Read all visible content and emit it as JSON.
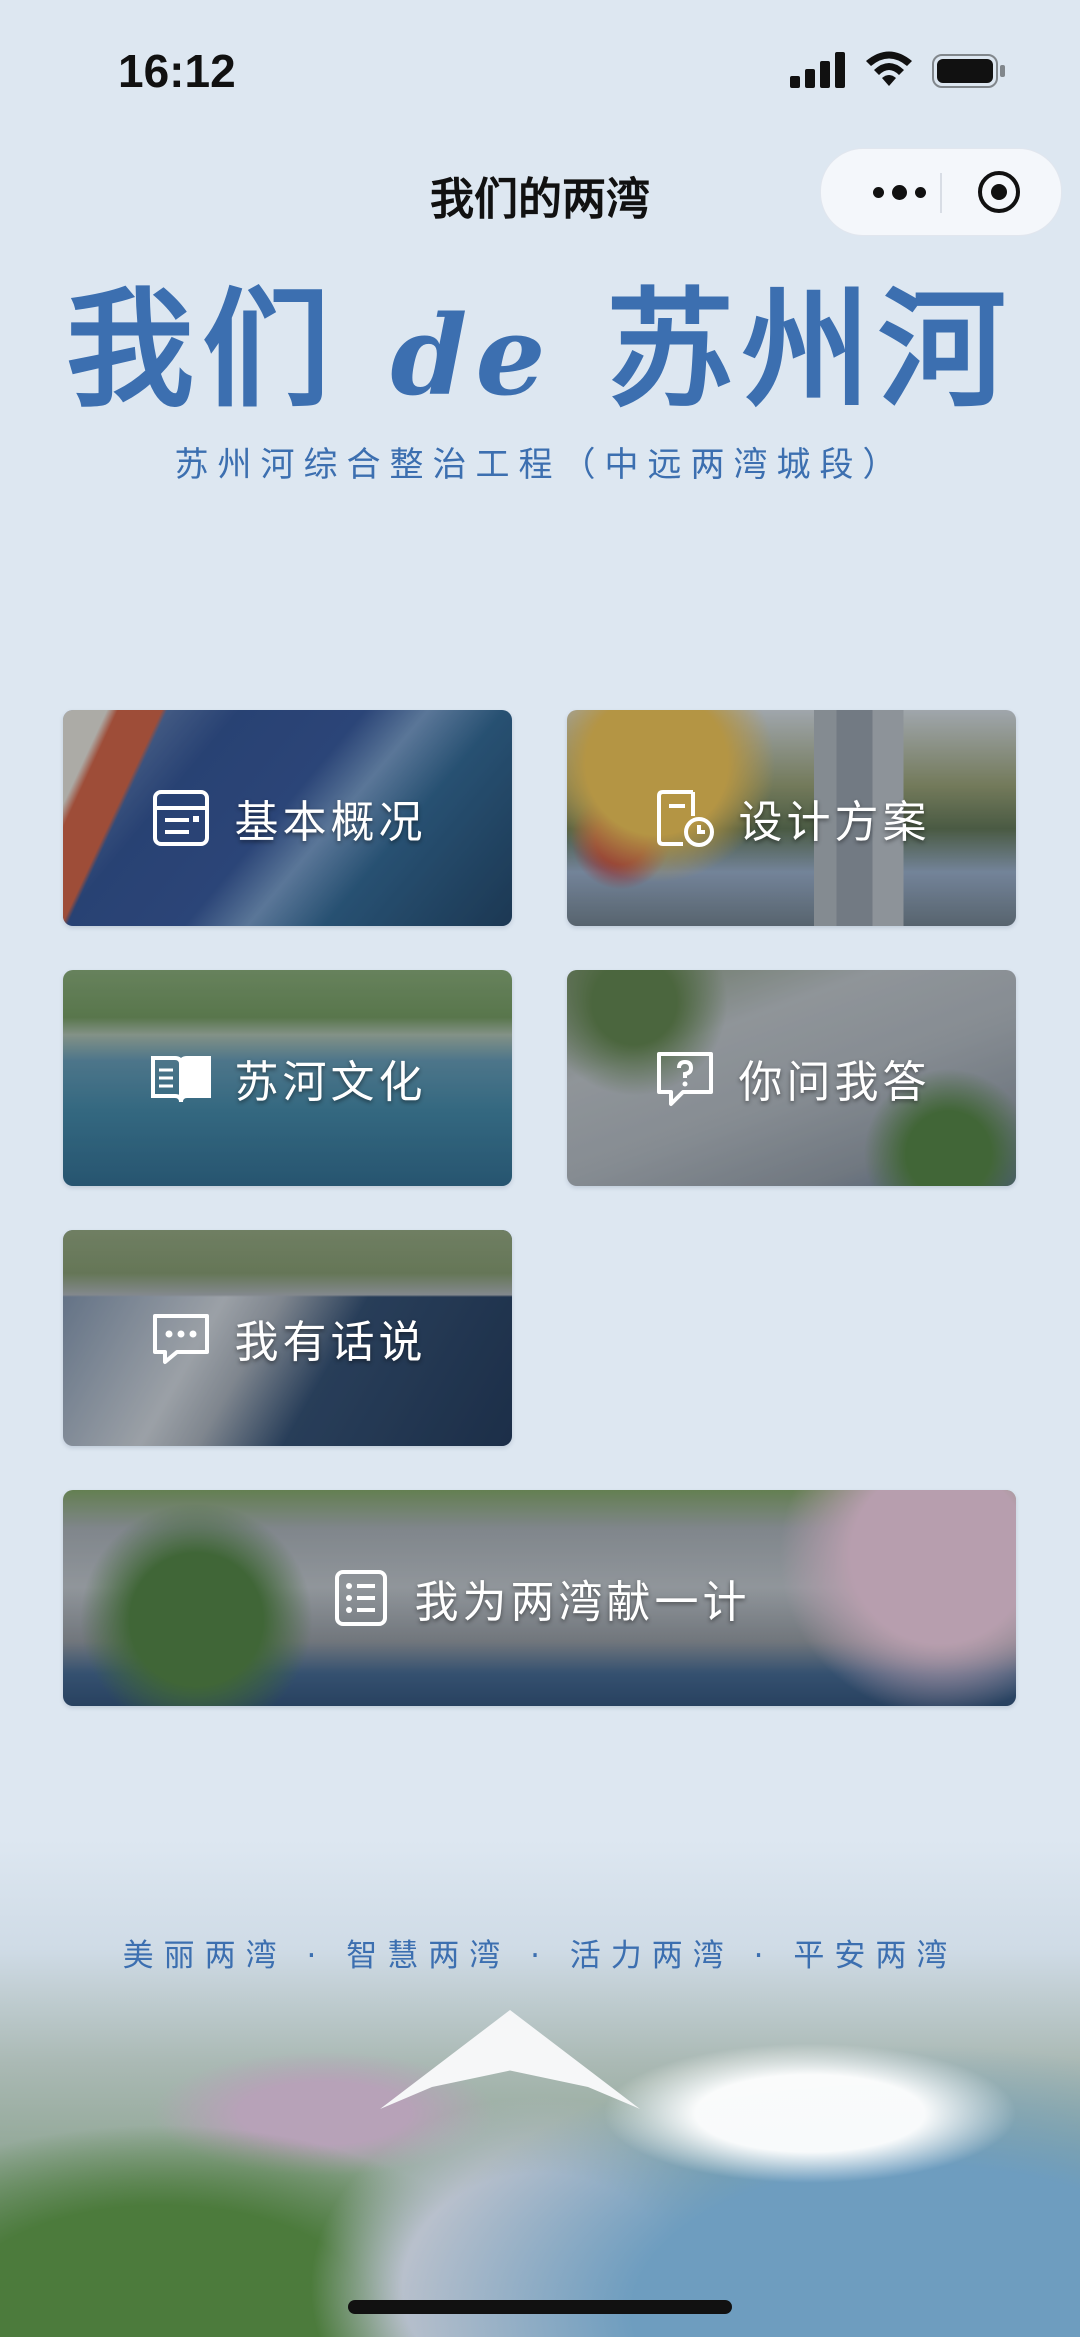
{
  "status_bar": {
    "time": "16:12"
  },
  "nav": {
    "title": "我们的两湾"
  },
  "hero": {
    "title_part1": "我们 ",
    "title_latin": "de",
    "title_part2": " 苏州河",
    "subtitle": "苏州河综合整治工程（中远两湾城段）"
  },
  "tiles": [
    {
      "label": "基本概况",
      "icon": "document-list-icon"
    },
    {
      "label": "设计方案",
      "icon": "document-clock-icon"
    },
    {
      "label": "苏河文化",
      "icon": "open-book-icon"
    },
    {
      "label": "你问我答",
      "icon": "question-chat-icon"
    },
    {
      "label": "我有话说",
      "icon": "chat-bubble-icon"
    },
    {
      "label": "我为两湾献一计",
      "icon": "checklist-icon"
    }
  ],
  "footer": {
    "slogan": "美丽两湾 · 智慧两湾 · 活力两湾 · 平安两湾"
  }
}
